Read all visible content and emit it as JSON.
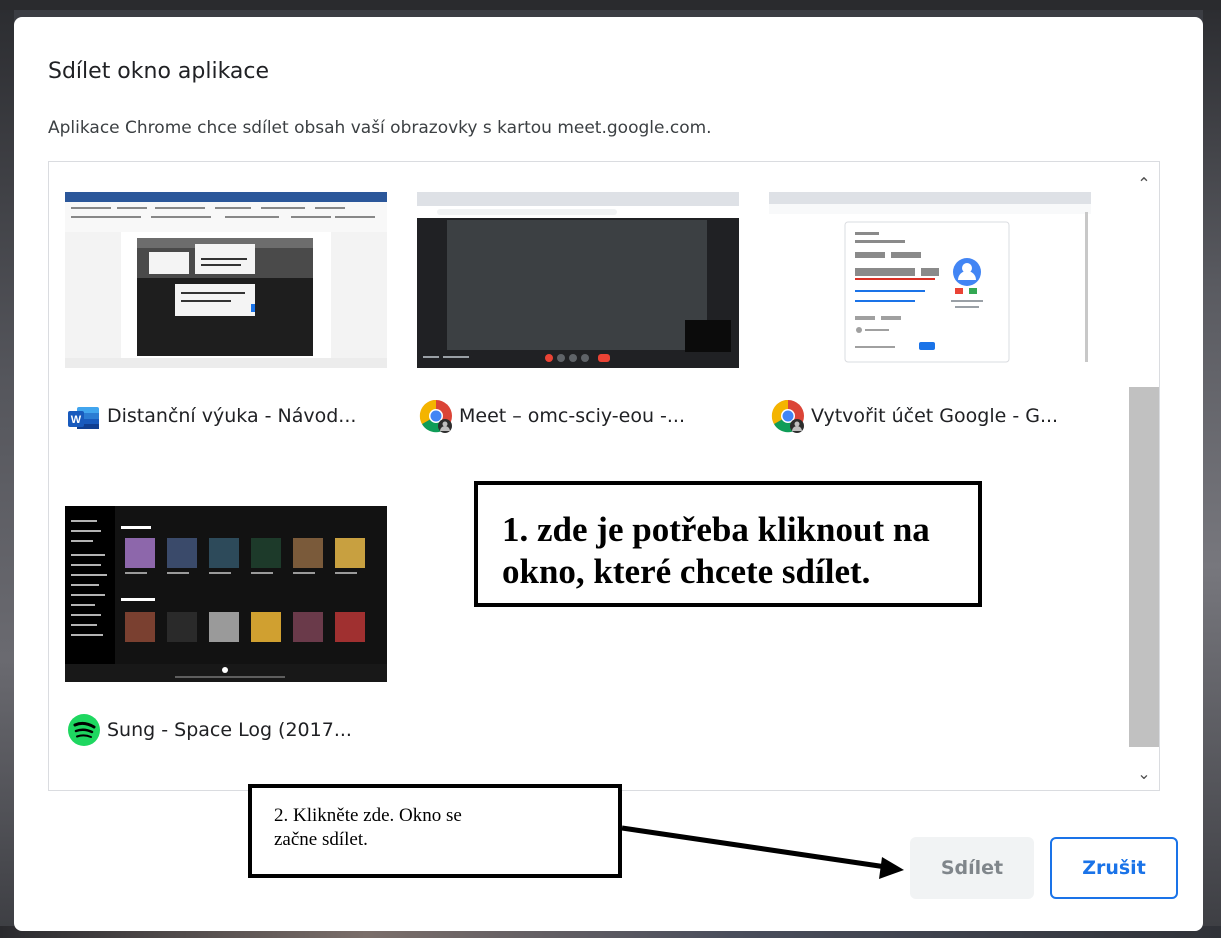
{
  "dialog": {
    "title": "Sdílet okno aplikace",
    "subtitle": "Aplikace Chrome chce sdílet obsah vaší obrazovky s kartou meet.google.com."
  },
  "windows": [
    {
      "label": "Distanční výuka - Návod...",
      "app_icon": "word-icon"
    },
    {
      "label": "Meet – omc-sciy-eou -...",
      "app_icon": "chrome-icon"
    },
    {
      "label": "Vytvořit účet Google - G...",
      "app_icon": "chrome-icon"
    },
    {
      "label": "Sung - Space Log (2017...",
      "app_icon": "spotify-icon"
    }
  ],
  "buttons": {
    "share_label": "Sdílet",
    "cancel_label": "Zrušit"
  },
  "annotations": {
    "callout1_line1": "1. zde je potřeba kliknout na",
    "callout1_line2": "okno, které chcete sdílet.",
    "callout2_line1": "2. Klikněte zde. Okno se",
    "callout2_line2": "začne sdílet."
  },
  "colors": {
    "accent": "#1a73e8",
    "disabled_button_bg": "#f1f3f4",
    "spotify_green": "#1ed760",
    "word_blue": "#2b579a"
  }
}
